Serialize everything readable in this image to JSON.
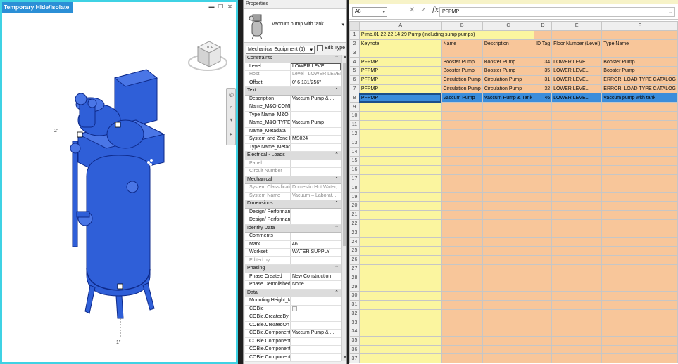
{
  "viewport": {
    "title": "Temporary Hide/Isolate",
    "dimension_top": "2\"",
    "dimension_bottom": "1\"",
    "view_cube_face": "TOP",
    "colors": {
      "isolate_frame": "#3fd2e4",
      "element_blue": "#2f5fd8",
      "element_edge": "#0e2a8a"
    }
  },
  "properties": {
    "title": "Properties",
    "type_name": "Vaccum pump with tank",
    "filter_value": "Mechanical Equipment (1)",
    "edit_type_label": "Edit Type",
    "sections": [
      {
        "name": "Constraints",
        "rows": [
          {
            "key": "Level",
            "value": "LOWER LEVEL",
            "grey": false,
            "boxed": true
          },
          {
            "key": "Host",
            "value": "Level : LOWER LEVEL",
            "grey": true
          },
          {
            "key": "Offset",
            "value": "0'  6 131/256\"",
            "grey": false
          }
        ]
      },
      {
        "name": "Text",
        "rows": [
          {
            "key": "Description",
            "value": "Vaccum Pump & ...",
            "grey": false
          },
          {
            "key": "Name_M&O COMP...",
            "value": "",
            "grey": false
          },
          {
            "key": "Type Name_M&O C...",
            "value": "",
            "grey": false
          },
          {
            "key": "Name_M&O TYPE",
            "value": "Vaccum Pump",
            "grey": false
          },
          {
            "key": "Name_Metadata",
            "value": "",
            "grey": false
          },
          {
            "key": "System and Zone Inf...",
            "value": "MS024",
            "grey": false
          },
          {
            "key": "Type Name_Metadata",
            "value": "",
            "grey": false
          }
        ]
      },
      {
        "name": "Electrical - Loads",
        "rows": [
          {
            "key": "Panel",
            "value": "",
            "grey": true
          },
          {
            "key": "Circuit Number",
            "value": "",
            "grey": true
          }
        ]
      },
      {
        "name": "Mechanical",
        "rows": [
          {
            "key": "System Classification",
            "value": "Domestic Hot Water,...",
            "grey": true
          },
          {
            "key": "System Name",
            "value": "Vacuum – Laborat...",
            "grey": true
          }
        ]
      },
      {
        "name": "Dimensions",
        "rows": [
          {
            "key": "Design/ Performanc...",
            "value": "",
            "grey": false
          },
          {
            "key": "Design/ Performanc...",
            "value": "",
            "grey": false
          }
        ]
      },
      {
        "name": "Identity Data",
        "rows": [
          {
            "key": "Comments",
            "value": "",
            "grey": false
          },
          {
            "key": "Mark",
            "value": "46",
            "grey": false
          },
          {
            "key": "Workset",
            "value": "WATER SUPPLY",
            "grey": false
          },
          {
            "key": "Edited by",
            "value": "",
            "grey": true
          }
        ]
      },
      {
        "name": "Phasing",
        "rows": [
          {
            "key": "Phase Created",
            "value": "New Construction",
            "grey": false
          },
          {
            "key": "Phase Demolished",
            "value": "None",
            "grey": false
          }
        ]
      },
      {
        "name": "Data",
        "rows": [
          {
            "key": "Mounting Height_M...",
            "value": "",
            "grey": false
          },
          {
            "key": "COBie",
            "value": "",
            "grey": false,
            "checkbox": true
          },
          {
            "key": "COBie.CreatedBy",
            "value": "",
            "grey": false
          },
          {
            "key": "COBie.CreatedOn",
            "value": "",
            "grey": false
          },
          {
            "key": "COBie.Component....",
            "value": "Vaccum Pump & ...",
            "grey": false
          },
          {
            "key": "COBie.Component.S...",
            "value": "",
            "grey": false
          },
          {
            "key": "COBie.Component....",
            "value": "",
            "grey": false
          },
          {
            "key": "COBie.Component.S...",
            "value": "",
            "grey": false
          }
        ]
      }
    ]
  },
  "excel": {
    "name_box": "A8",
    "formula": "PFPMP",
    "columns": [
      "A",
      "B",
      "C",
      "D",
      "E",
      "F"
    ],
    "row1_title": "Plmb.01 22-22 14 29 Pump (including sump pumps)",
    "header_row": [
      "Keynote",
      "Name",
      "Description",
      "ID Tag",
      "Floor Number (Level)",
      "Type Name"
    ],
    "data_rows": [
      [
        "PFPMP",
        "Booster Pump",
        "Booster Pump",
        "34",
        "LOWER LEVEL",
        "Booster Pump"
      ],
      [
        "PFPMP",
        "Booster Pump",
        "Booster Pump",
        "35",
        "LOWER LEVEL",
        "Booster Pump"
      ],
      [
        "PFPMP",
        "Circulation Pump",
        "Circulation Pump",
        "31",
        "LOWER LEVEL",
        "ERROR_LOAD TYPE CATALOG"
      ],
      [
        "PFPMP",
        "Circulation Pump",
        "Circulation Pump",
        "32",
        "LOWER LEVEL",
        "ERROR_LOAD TYPE CATALOG"
      ],
      [
        "PFPMP",
        "Vaccum Pump",
        "Vaccum Pump & Tank",
        "46",
        "LOWER LEVEL",
        "Vaccum pump with tank"
      ]
    ],
    "selected_row": 8,
    "total_rows": 37,
    "colors": {
      "keynote_col": "#fbf59f",
      "other_cols": "#f8c69a",
      "selection": "#3b8ddb"
    }
  }
}
